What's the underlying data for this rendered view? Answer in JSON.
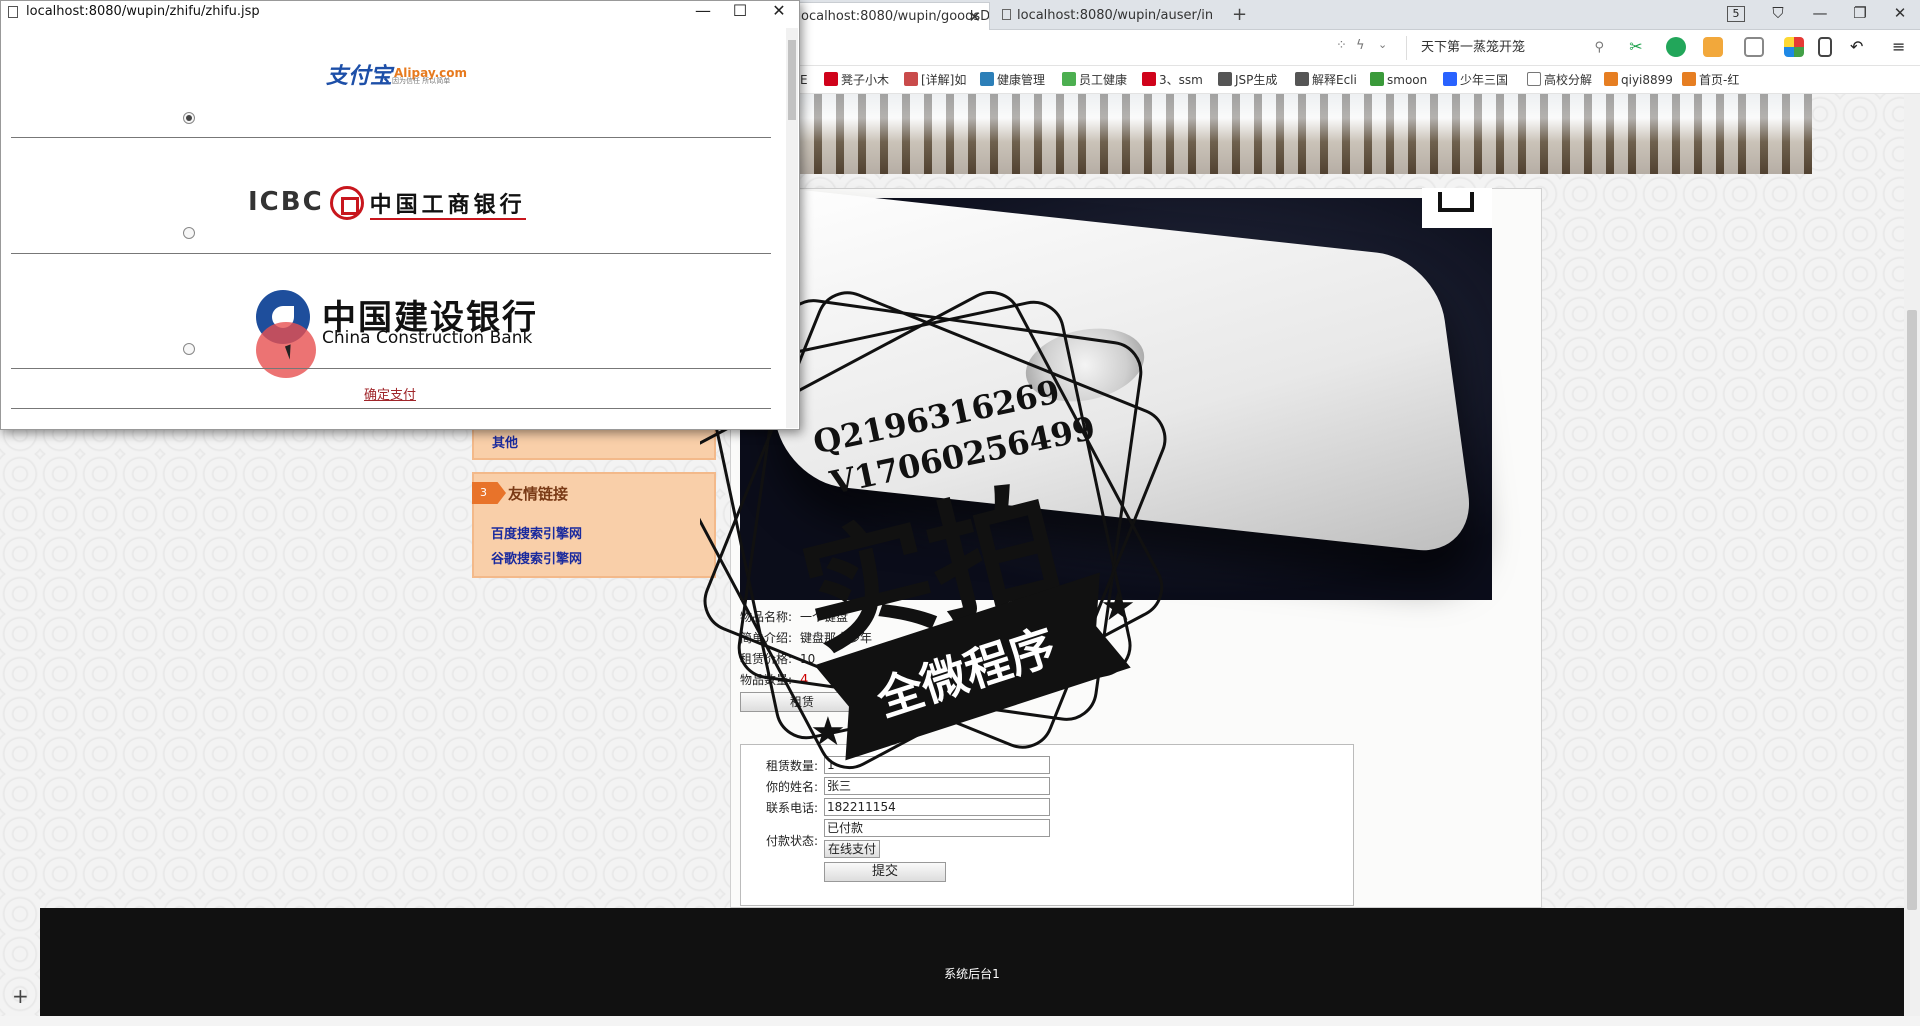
{
  "browser": {
    "tabs": [
      {
        "label": "ocalhost:8080/wupin/goodsD"
      },
      {
        "label": "localhost:8080/wupin/auser/in"
      }
    ],
    "tab_count": "5",
    "search_placeholder": "天下第一蒸笼开笼",
    "bookmarks": [
      {
        "label": "E",
        "icon": "page-icon",
        "color": "#777777"
      },
      {
        "label": "凳子小木",
        "icon": "t-icon",
        "color": "#d0021b"
      },
      {
        "label": "[详解]如",
        "icon": "jian-icon",
        "color": "#c94b4b"
      },
      {
        "label": "健康管理",
        "icon": "grid-icon",
        "color": "#2c7fb8"
      },
      {
        "label": "员工健康",
        "icon": "leaf-icon",
        "color": "#4caf50"
      },
      {
        "label": "3、ssm",
        "icon": "c-icon",
        "color": "#d0021b"
      },
      {
        "label": "JSP生成",
        "icon": "feather-icon",
        "color": "#555555"
      },
      {
        "label": "解释Ecli",
        "icon": "feather-icon",
        "color": "#555555"
      },
      {
        "label": "smoon",
        "icon": "frog-icon",
        "color": "#3a9a3a"
      },
      {
        "label": "少年三国",
        "icon": "paw-icon",
        "color": "#2962ff"
      },
      {
        "label": "高校分解",
        "icon": "page-icon",
        "color": "#777777"
      },
      {
        "label": "qiyi8899",
        "icon": "star-icon",
        "color": "#e67e22"
      },
      {
        "label": "首页-红",
        "icon": "star-icon",
        "color": "#e67e22"
      }
    ]
  },
  "popup": {
    "title": "localhost:8080/wupin/zhifu/zhifu.jsp",
    "alipay": {
      "cn": "支付宝",
      "en": "Alipay.com",
      "sub": "因为信任 所以简单"
    },
    "icbc": {
      "en": "ICBC",
      "cn": "中国工商银行"
    },
    "ccb": {
      "cn": "中国建设银行",
      "en": "China Construction Bank"
    },
    "selected": "alipay",
    "confirm_label": "确定支付"
  },
  "sidebar": {
    "other_link": "其他",
    "friend_number": "3",
    "friend_title": "友情链接",
    "links": [
      "百度搜索引擎网",
      "谷歌搜索引擎网"
    ]
  },
  "product": {
    "name_label": "物品名称:",
    "name_value": "一个键盘",
    "intro_label": "简单介绍:",
    "intro_value": "键盘那十多年",
    "price_label": "租赁价格:",
    "price_value": "10",
    "qty_label": "物品数量:",
    "qty_value": "4",
    "rent_button": "租赁"
  },
  "order_form": {
    "qty_label": "租赁数量:",
    "qty_value": "1",
    "name_label": "你的姓名:",
    "name_value": "张三",
    "phone_label": "联系电话:",
    "phone_value": "182211154",
    "pay_status_label": "付款状态:",
    "pay_status_value": "已付款",
    "online_pay_button": "在线支付",
    "submit_button": "提交"
  },
  "watermark": {
    "line1": "Q2196316269",
    "line2": "V17060256499",
    "big": "实拍",
    "ribbon": "全微程序"
  },
  "footer": {
    "text": "系统后台1"
  }
}
